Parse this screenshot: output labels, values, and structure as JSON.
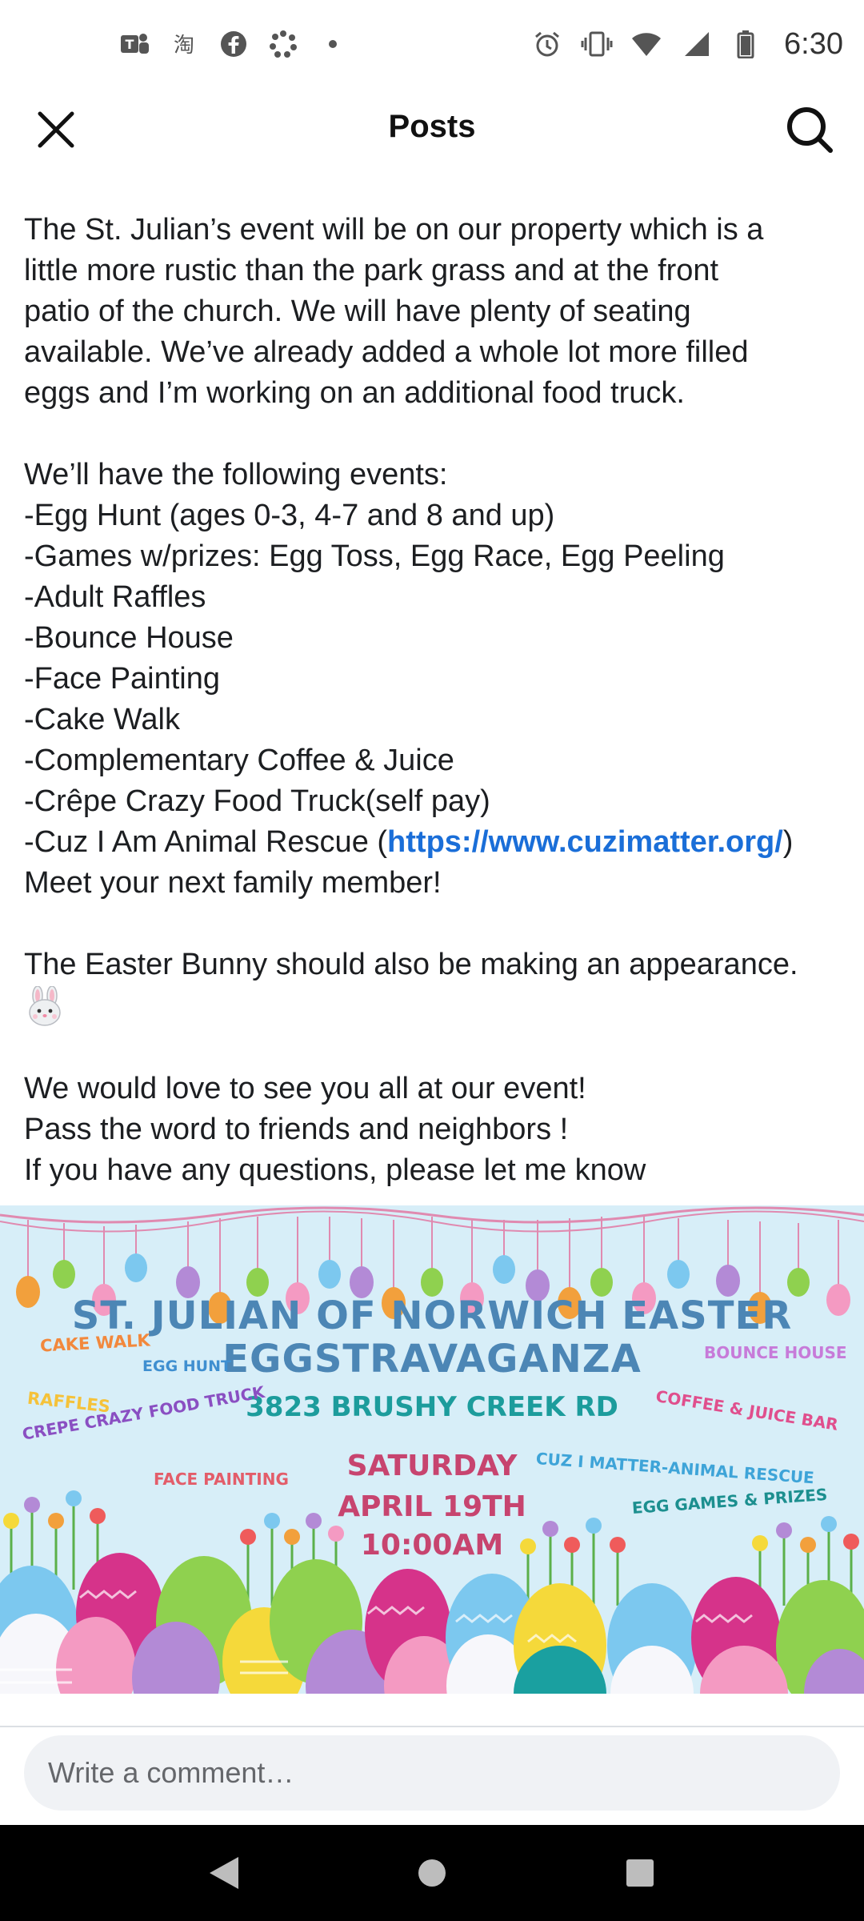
{
  "status_bar": {
    "time": "6:30",
    "left_icons": [
      "teams-icon",
      "taobao-icon",
      "facebook-icon",
      "pinwheel-icon",
      "dot-icon"
    ],
    "right_icons": [
      "alarm-icon",
      "vibrate-icon",
      "wifi-icon",
      "signal-icon",
      "battery-icon"
    ]
  },
  "header": {
    "title": "Posts",
    "close_icon": "close-icon",
    "search_icon": "search-icon"
  },
  "post": {
    "paragraph1": [
      "The St. Julian’s event will be on our property which is a",
      "little more rustic than the park grass and at the front",
      "patio of the church.  We will have plenty of seating",
      "available.  We’ve already added a whole lot more filled",
      "eggs and I’m working on an additional food truck."
    ],
    "events_intro": "We’ll have the following events:",
    "events": [
      "-Egg Hunt (ages 0-3, 4-7 and 8 and up)",
      "-Games w/prizes: Egg Toss, Egg Race, Egg Peeling",
      "-Adult Raffles",
      "-Bounce House",
      "-Face Painting",
      "-Cake Walk",
      "-Complementary Coffee & Juice",
      "-Crêpe Crazy Food Truck(self pay)"
    ],
    "rescue_prefix": "-Cuz I Am Animal Rescue (",
    "rescue_link": "https://www.cuzimatter.org/",
    "rescue_suffix": ")",
    "family_line": "Meet your next family member!",
    "bunny_line": "The Easter Bunny should also be making an appearance.",
    "closing": [
      "We would love to see you all at our event!",
      "Pass the word to friends and neighbors !",
      "If you have any questions, please let me know"
    ]
  },
  "flyer": {
    "title_line1": "ST. JULIAN OF NORWICH EASTER",
    "title_line2": "EGGSTRAVAGANZA",
    "address": "3823 BRUSHY CREEK RD",
    "day": "SATURDAY",
    "date": "APRIL 19TH",
    "time": "10:00AM",
    "labels": {
      "cake_walk": "CAKE WALK",
      "egg_hunt": "EGG HUNT",
      "raffles": "RAFFLES",
      "crepe": "CREPE CRAZY FOOD TRUCK",
      "face_painting": "FACE PAINTING",
      "bounce_house": "BOUNCE HOUSE",
      "coffee": "COFFEE & JUICE BAR",
      "rescue": "CUZ I MATTER-ANIMAL RESCUE",
      "games": "EGG GAMES & PRIZES"
    },
    "colors": {
      "background": "#d7eef8",
      "title": "#4c86b5",
      "address": "#1c9c9c",
      "date": "#c7446f"
    }
  },
  "comment": {
    "placeholder": "Write a comment…"
  },
  "nav": {
    "back_icon": "back-triangle-icon",
    "home_icon": "home-circle-icon",
    "recents_icon": "recents-square-icon"
  }
}
